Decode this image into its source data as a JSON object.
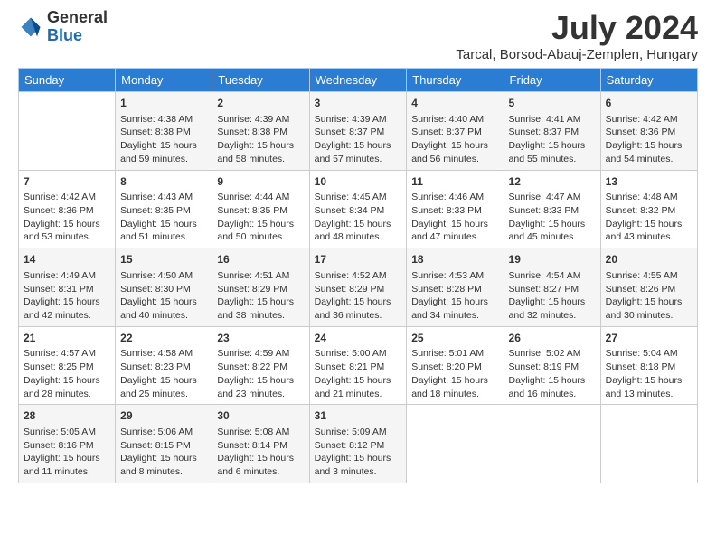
{
  "header": {
    "logo_line1": "General",
    "logo_line2": "Blue",
    "title": "July 2024",
    "subtitle": "Tarcal, Borsod-Abauj-Zemplen, Hungary"
  },
  "weekdays": [
    "Sunday",
    "Monday",
    "Tuesday",
    "Wednesday",
    "Thursday",
    "Friday",
    "Saturday"
  ],
  "weeks": [
    [
      {
        "day": "",
        "info": ""
      },
      {
        "day": "1",
        "info": "Sunrise: 4:38 AM\nSunset: 8:38 PM\nDaylight: 15 hours\nand 59 minutes."
      },
      {
        "day": "2",
        "info": "Sunrise: 4:39 AM\nSunset: 8:38 PM\nDaylight: 15 hours\nand 58 minutes."
      },
      {
        "day": "3",
        "info": "Sunrise: 4:39 AM\nSunset: 8:37 PM\nDaylight: 15 hours\nand 57 minutes."
      },
      {
        "day": "4",
        "info": "Sunrise: 4:40 AM\nSunset: 8:37 PM\nDaylight: 15 hours\nand 56 minutes."
      },
      {
        "day": "5",
        "info": "Sunrise: 4:41 AM\nSunset: 8:37 PM\nDaylight: 15 hours\nand 55 minutes."
      },
      {
        "day": "6",
        "info": "Sunrise: 4:42 AM\nSunset: 8:36 PM\nDaylight: 15 hours\nand 54 minutes."
      }
    ],
    [
      {
        "day": "7",
        "info": "Sunrise: 4:42 AM\nSunset: 8:36 PM\nDaylight: 15 hours\nand 53 minutes."
      },
      {
        "day": "8",
        "info": "Sunrise: 4:43 AM\nSunset: 8:35 PM\nDaylight: 15 hours\nand 51 minutes."
      },
      {
        "day": "9",
        "info": "Sunrise: 4:44 AM\nSunset: 8:35 PM\nDaylight: 15 hours\nand 50 minutes."
      },
      {
        "day": "10",
        "info": "Sunrise: 4:45 AM\nSunset: 8:34 PM\nDaylight: 15 hours\nand 48 minutes."
      },
      {
        "day": "11",
        "info": "Sunrise: 4:46 AM\nSunset: 8:33 PM\nDaylight: 15 hours\nand 47 minutes."
      },
      {
        "day": "12",
        "info": "Sunrise: 4:47 AM\nSunset: 8:33 PM\nDaylight: 15 hours\nand 45 minutes."
      },
      {
        "day": "13",
        "info": "Sunrise: 4:48 AM\nSunset: 8:32 PM\nDaylight: 15 hours\nand 43 minutes."
      }
    ],
    [
      {
        "day": "14",
        "info": "Sunrise: 4:49 AM\nSunset: 8:31 PM\nDaylight: 15 hours\nand 42 minutes."
      },
      {
        "day": "15",
        "info": "Sunrise: 4:50 AM\nSunset: 8:30 PM\nDaylight: 15 hours\nand 40 minutes."
      },
      {
        "day": "16",
        "info": "Sunrise: 4:51 AM\nSunset: 8:29 PM\nDaylight: 15 hours\nand 38 minutes."
      },
      {
        "day": "17",
        "info": "Sunrise: 4:52 AM\nSunset: 8:29 PM\nDaylight: 15 hours\nand 36 minutes."
      },
      {
        "day": "18",
        "info": "Sunrise: 4:53 AM\nSunset: 8:28 PM\nDaylight: 15 hours\nand 34 minutes."
      },
      {
        "day": "19",
        "info": "Sunrise: 4:54 AM\nSunset: 8:27 PM\nDaylight: 15 hours\nand 32 minutes."
      },
      {
        "day": "20",
        "info": "Sunrise: 4:55 AM\nSunset: 8:26 PM\nDaylight: 15 hours\nand 30 minutes."
      }
    ],
    [
      {
        "day": "21",
        "info": "Sunrise: 4:57 AM\nSunset: 8:25 PM\nDaylight: 15 hours\nand 28 minutes."
      },
      {
        "day": "22",
        "info": "Sunrise: 4:58 AM\nSunset: 8:23 PM\nDaylight: 15 hours\nand 25 minutes."
      },
      {
        "day": "23",
        "info": "Sunrise: 4:59 AM\nSunset: 8:22 PM\nDaylight: 15 hours\nand 23 minutes."
      },
      {
        "day": "24",
        "info": "Sunrise: 5:00 AM\nSunset: 8:21 PM\nDaylight: 15 hours\nand 21 minutes."
      },
      {
        "day": "25",
        "info": "Sunrise: 5:01 AM\nSunset: 8:20 PM\nDaylight: 15 hours\nand 18 minutes."
      },
      {
        "day": "26",
        "info": "Sunrise: 5:02 AM\nSunset: 8:19 PM\nDaylight: 15 hours\nand 16 minutes."
      },
      {
        "day": "27",
        "info": "Sunrise: 5:04 AM\nSunset: 8:18 PM\nDaylight: 15 hours\nand 13 minutes."
      }
    ],
    [
      {
        "day": "28",
        "info": "Sunrise: 5:05 AM\nSunset: 8:16 PM\nDaylight: 15 hours\nand 11 minutes."
      },
      {
        "day": "29",
        "info": "Sunrise: 5:06 AM\nSunset: 8:15 PM\nDaylight: 15 hours\nand 8 minutes."
      },
      {
        "day": "30",
        "info": "Sunrise: 5:08 AM\nSunset: 8:14 PM\nDaylight: 15 hours\nand 6 minutes."
      },
      {
        "day": "31",
        "info": "Sunrise: 5:09 AM\nSunset: 8:12 PM\nDaylight: 15 hours\nand 3 minutes."
      },
      {
        "day": "",
        "info": ""
      },
      {
        "day": "",
        "info": ""
      },
      {
        "day": "",
        "info": ""
      }
    ]
  ]
}
